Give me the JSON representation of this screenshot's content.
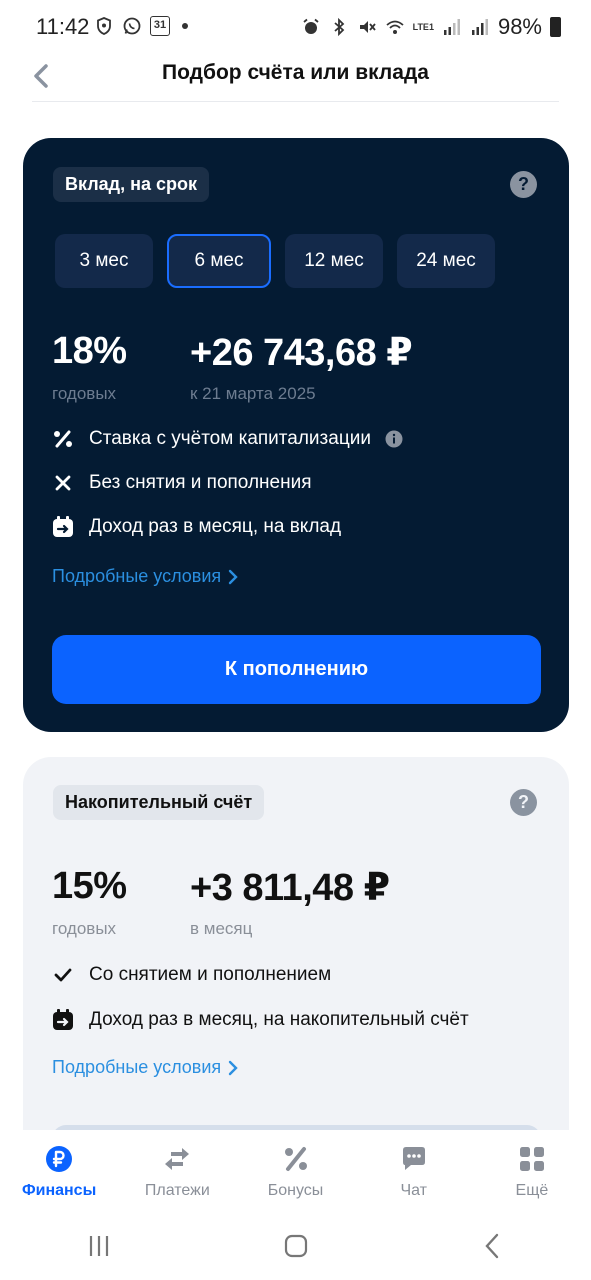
{
  "status_bar": {
    "time": "11:42",
    "calendar_day": "31",
    "battery": "98%",
    "network_label": "LTE1"
  },
  "header": {
    "title": "Подбор счёта или вклада"
  },
  "deposit_card": {
    "chip": "Вклад, на срок",
    "help": "?",
    "terms": [
      "3 мес",
      "6 мес",
      "12 мес",
      "24 мес"
    ],
    "selected_term": "6 мес",
    "rate": "18%",
    "rate_caption": "годовых",
    "income": "+26 743,68 ₽",
    "income_caption": "к 21 марта 2025",
    "features": [
      {
        "icon": "percent-icon",
        "text": "Ставка с учётом капитализации"
      },
      {
        "icon": "close-icon",
        "text": "Без снятия и пополнения"
      },
      {
        "icon": "calendar-transfer-icon",
        "text": "Доход раз в месяц, на вклад"
      }
    ],
    "details_link": "Подробные условия",
    "action_button": "К пополнению"
  },
  "savings_card": {
    "chip": "Накопительный счёт",
    "help": "?",
    "rate": "15%",
    "rate_caption": "годовых",
    "income": "+3 811,48 ₽",
    "income_caption": "в месяц",
    "features": [
      {
        "icon": "check-icon",
        "text": "Со снятием и пополнением"
      },
      {
        "icon": "calendar-transfer-icon",
        "text": "Доход раз в месяц, на накопительный счёт"
      }
    ],
    "details_link": "Подробные условия"
  },
  "bottom_nav": [
    {
      "label": "Финансы",
      "icon": "ruble-icon",
      "active": true
    },
    {
      "label": "Платежи",
      "icon": "transfer-arrows-icon",
      "active": false
    },
    {
      "label": "Бонусы",
      "icon": "percent-icon",
      "active": false
    },
    {
      "label": "Чат",
      "icon": "chat-icon",
      "active": false
    },
    {
      "label": "Ещё",
      "icon": "grid-icon",
      "active": false
    }
  ],
  "colors": {
    "dark_card": "#041b33",
    "accent": "#0b63ff",
    "link": "#2b8fe0",
    "light_card": "#f1f3f7"
  }
}
